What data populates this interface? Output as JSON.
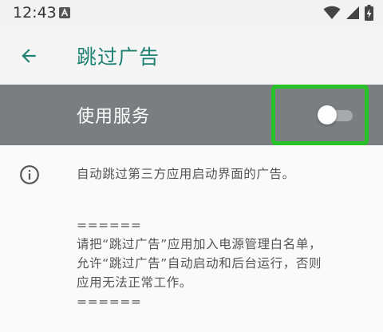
{
  "status_bar": {
    "time": "12:43",
    "icons": [
      "a-notification-icon",
      "wifi-icon",
      "cell-signal-icon",
      "battery-charging-icon"
    ]
  },
  "app_bar": {
    "back_icon": "arrow-back-icon",
    "title": "跳过广告"
  },
  "service_row": {
    "label": "使用服务",
    "switch_on": false,
    "highlight_color": "#27c227"
  },
  "info": {
    "icon": "info-icon",
    "description": "自动跳过第三方应用启动界面的广告。",
    "note_lines": [
      "======",
      "请把“跳过广告”应用加入电源管理白名单，",
      "允许“跳过广告”自动启动和后台运行，否则",
      "应用无法正常工作。",
      "======"
    ]
  },
  "colors": {
    "accent": "#1f8074",
    "service_row_bg": "#7a7e80"
  }
}
